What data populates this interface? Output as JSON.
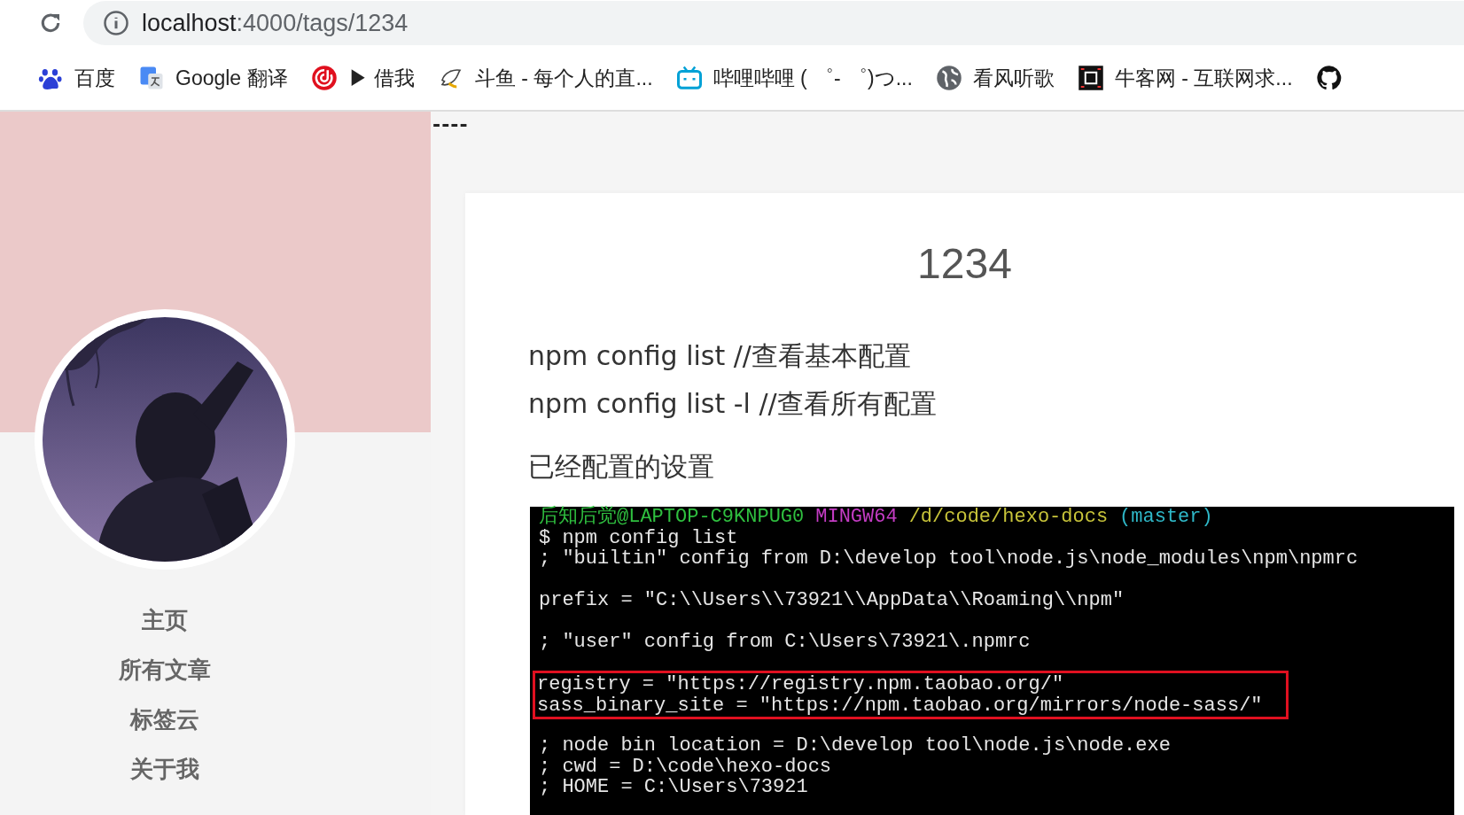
{
  "browser": {
    "url_host": "localhost",
    "url_path": ":4000/tags/1234"
  },
  "bookmarks": [
    "百度",
    "Google 翻译",
    "▶ 借我",
    "斗鱼 - 每个人的直...",
    "哔哩哔哩 ( ゜- ゜)つ...",
    "看风听歌",
    "牛客网 - 互联网求..."
  ],
  "sidebar": {
    "nav": [
      "主页",
      "所有文章",
      "标签云",
      "关于我"
    ]
  },
  "separator": "----",
  "post": {
    "title": "1234",
    "lines": [
      "npm config list //查看基本配置",
      "npm config list -l //查看所有配置"
    ],
    "subheading": "已经配置的设置",
    "terminal": {
      "prompt": [
        {
          "text": "后知后觉@LAPTOP-C9KNPUG0",
          "color": "#2fbf3f"
        },
        {
          "text": "MINGW64",
          "color": "#c43cc4"
        },
        {
          "text": "/d/code/hexo-docs",
          "color": "#c8c43a"
        },
        {
          "text": "(master)",
          "color": "#2fb8c8"
        }
      ],
      "blocks": [
        {
          "highlighted": false,
          "lines": [
            "$ npm config list",
            "; \"builtin\" config from D:\\develop tool\\node.js\\node_modules\\npm\\npmrc"
          ]
        },
        {
          "highlighted": false,
          "lines": [
            "prefix = \"C:\\\\Users\\\\73921\\\\AppData\\\\Roaming\\\\npm\""
          ]
        },
        {
          "highlighted": false,
          "lines": [
            "; \"user\" config from C:\\Users\\73921\\.npmrc"
          ]
        },
        {
          "highlighted": true,
          "lines": [
            "registry = \"https://registry.npm.taobao.org/\"",
            "sass_binary_site = \"https://npm.taobao.org/mirrors/node-sass/\""
          ]
        },
        {
          "highlighted": false,
          "lines": [
            "; node bin location = D:\\develop tool\\node.js\\node.exe",
            "; cwd = D:\\code\\hexo-docs",
            "; HOME = C:\\Users\\73921"
          ]
        }
      ]
    }
  }
}
